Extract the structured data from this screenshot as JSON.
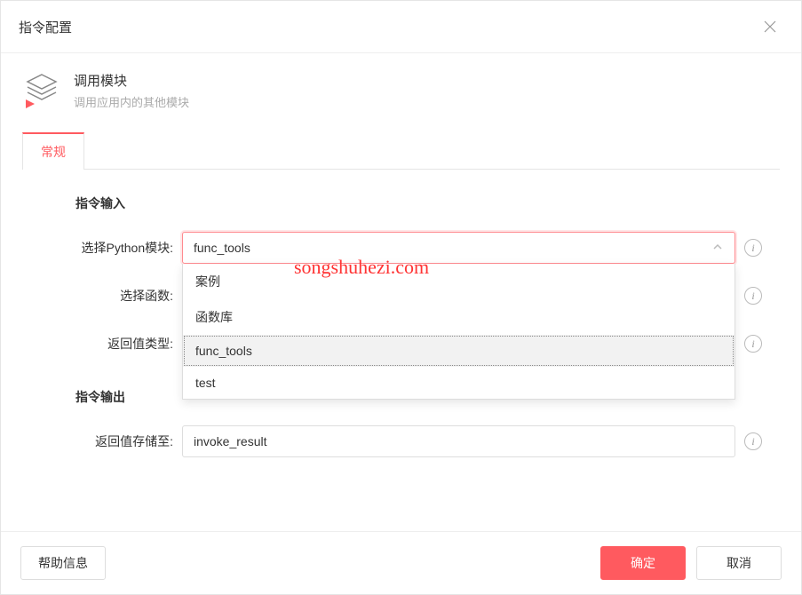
{
  "dialog": {
    "title": "指令配置"
  },
  "module": {
    "title": "调用模块",
    "description": "调用应用内的其他模块"
  },
  "tabs": {
    "general": "常规"
  },
  "sections": {
    "input": "指令输入",
    "output": "指令输出"
  },
  "fields": {
    "python_module": {
      "label": "选择Python模块:",
      "value": "func_tools",
      "options": [
        "案例",
        "函数库",
        "func_tools",
        "test"
      ],
      "highlighted_index": 2
    },
    "function": {
      "label": "选择函数:"
    },
    "return_type": {
      "label": "返回值类型:"
    },
    "return_store": {
      "label": "返回值存储至:",
      "value": "invoke_result"
    }
  },
  "footer": {
    "help": "帮助信息",
    "ok": "确定",
    "cancel": "取消"
  },
  "watermark": "songshuhezi.com"
}
